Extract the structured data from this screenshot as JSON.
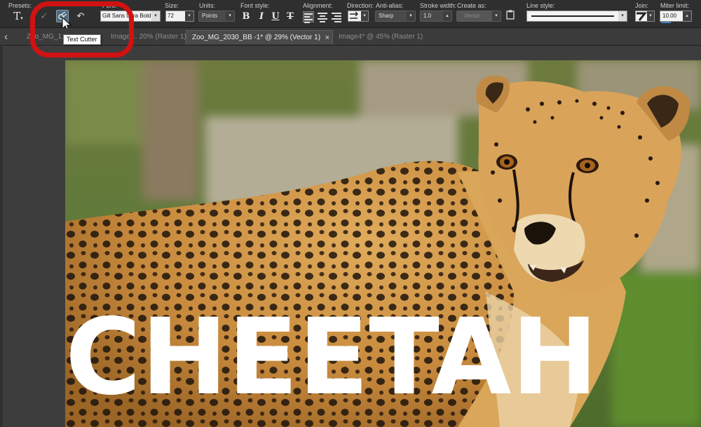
{
  "toolbar": {
    "presets_label": "Presets:",
    "font_label": "Font:",
    "font_value": "Gill Sans Ultra Bold",
    "size_label": "Size:",
    "size_value": "72",
    "units_label": "Units:",
    "units_value": "Points",
    "font_style_label": "Font style:",
    "bold_glyph": "B",
    "italic_glyph": "I",
    "underline_glyph": "U",
    "strike_glyph": "T",
    "alignment_label": "Alignment:",
    "direction_label": "Direction:",
    "antialias_label": "Anti-alias:",
    "antialias_value": "Sharp",
    "stroke_width_label": "Stroke width:",
    "stroke_width_value": "1.0",
    "create_as_label": "Create as:",
    "create_as_value": "Vector",
    "line_style_label": "Line style:",
    "join_label": "Join:",
    "miter_limit_label": "Miter limit:",
    "miter_limit_value": "10.00",
    "text_tool_glyph": "T",
    "apply_glyph": "✓",
    "undo_glyph": "↶"
  },
  "tooltip": "Text Cutter",
  "tabs": [
    {
      "label": "Zoo_MG_1…",
      "active": false
    },
    {
      "label": "Image… 20% (Raster 1)",
      "active": false
    },
    {
      "label": "Zoo_MG_2030_BB -1* @  29% (Vector 1)",
      "active": true
    },
    {
      "label": "Image4* @  45% (Raster 1)",
      "active": false
    }
  ],
  "tab_close_glyph": "×",
  "tab_scroll_glyph": "‹",
  "canvas_text": "CHEETAH",
  "colors": {
    "highlight": "#d11212",
    "text_fill": "#ffffff",
    "fur": "#d39a4c"
  }
}
